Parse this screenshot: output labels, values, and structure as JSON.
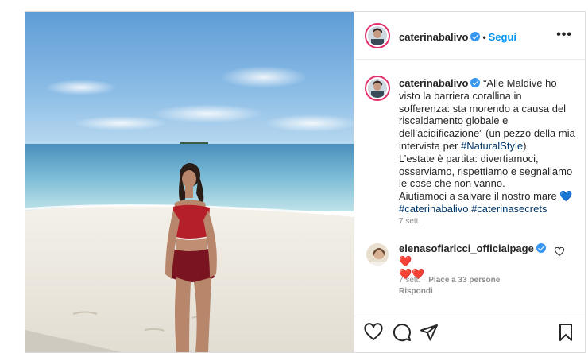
{
  "post": {
    "username": "caterinabalivo",
    "follow_label": "Segui",
    "separator": "•",
    "more_icon": "•••"
  },
  "caption": {
    "username": "caterinabalivo",
    "text_1": "“Alle Maldive ho visto la barriera corallina in sofferenza: sta morendo a causa del riscaldamento globale e dell’acidificazione” (un pezzo della mia intervista per ",
    "hashtag_1": "#NaturalStyle",
    "text_2": ")",
    "line_2": "L’estate è partita: divertiamoci, osserviamo, rispettiamo e segnaliamo le cose che non vanno.",
    "line_3": "Aiutiamoci a salvare il nostro mare",
    "heart": "💙",
    "hashtag_2": "#caterinabalivo",
    "hashtag_3": "#caterinasecrets",
    "time": "7 sett."
  },
  "comment": {
    "username": "elenasofiaricci_officialpage",
    "hearts_inline": "❤️",
    "hearts_line": "❤️❤️",
    "time": "7 sett.",
    "likes": "Piace a 33 persone",
    "reply": "Rispondi"
  },
  "icons": {
    "heart": "heart-icon",
    "comment": "comment-icon",
    "share": "share-icon",
    "save": "bookmark-icon"
  },
  "colors": {
    "link": "#0095f6",
    "hashtag": "#00376b",
    "verified": "#3897f0"
  }
}
